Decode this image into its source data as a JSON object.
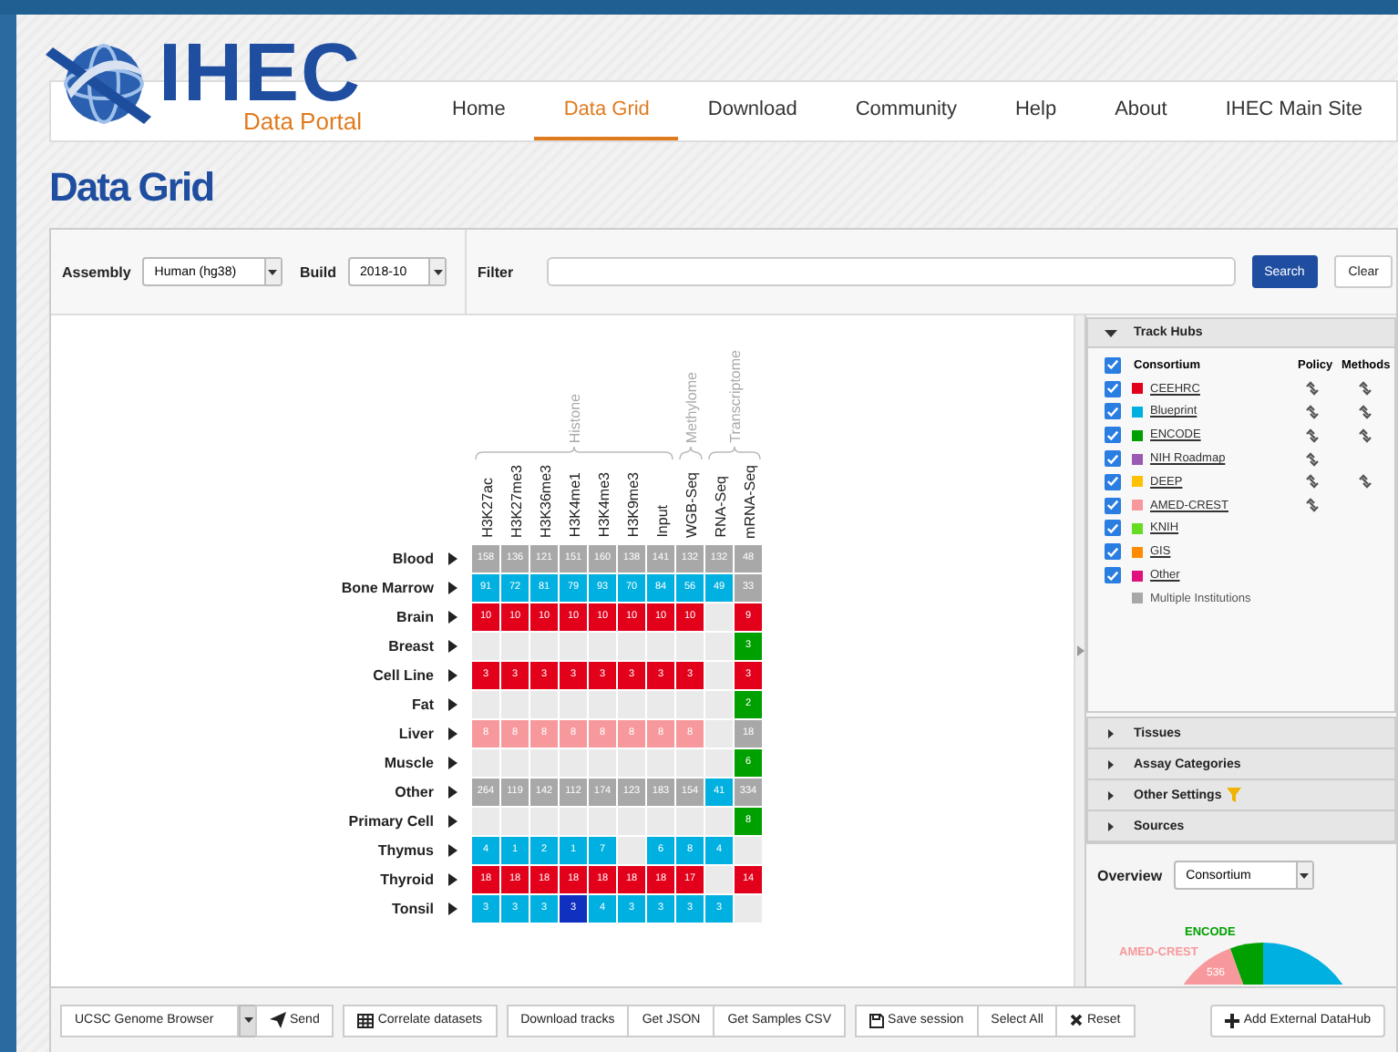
{
  "logo": {
    "title": "IHEC",
    "subtitle": "Data Portal"
  },
  "nav": [
    {
      "label": "Home",
      "selected": false
    },
    {
      "label": "Data Grid",
      "selected": true
    },
    {
      "label": "Download",
      "selected": false
    },
    {
      "label": "Community",
      "selected": false
    },
    {
      "label": "Help",
      "selected": false
    },
    {
      "label": "About",
      "selected": false
    },
    {
      "label": "IHEC Main Site",
      "selected": false
    }
  ],
  "page_title": "Data Grid",
  "filters": {
    "assembly": {
      "label": "Assembly",
      "value": "Human (hg38)"
    },
    "build": {
      "label": "Build",
      "value": "2018-10"
    },
    "filter": {
      "label": "Filter"
    },
    "search_button": "Search",
    "clear_button": "Clear"
  },
  "grid": {
    "groups": [
      {
        "label": "Histone",
        "columns": [
          "H3K27ac",
          "H3K27me3",
          "H3K36me3",
          "H3K4me1",
          "H3K4me3",
          "H3K9me3",
          "Input"
        ]
      },
      {
        "label": "Methylome",
        "columns": [
          "WGB-Seq"
        ]
      },
      {
        "label": "Transcriptome",
        "columns": [
          "RNA-Seq",
          "mRNA-Seq"
        ]
      }
    ],
    "rows": [
      {
        "label": "Blood",
        "cells": [
          {
            "value": "158",
            "color": "#a8a8a8"
          },
          {
            "value": "136",
            "color": "#a8a8a8"
          },
          {
            "value": "121",
            "color": "#a8a8a8"
          },
          {
            "value": "151",
            "color": "#a8a8a8"
          },
          {
            "value": "160",
            "color": "#a8a8a8"
          },
          {
            "value": "138",
            "color": "#a8a8a8"
          },
          {
            "value": "141",
            "color": "#a8a8a8"
          },
          {
            "value": "132",
            "color": "#a8a8a8"
          },
          {
            "value": "132",
            "color": "#a8a8a8"
          },
          {
            "value": "48",
            "color": "#a8a8a8"
          }
        ]
      },
      {
        "label": "Bone Marrow",
        "cells": [
          {
            "value": "91",
            "color": "#00b0e0"
          },
          {
            "value": "72",
            "color": "#00b0e0"
          },
          {
            "value": "81",
            "color": "#00b0e0"
          },
          {
            "value": "79",
            "color": "#00b0e0"
          },
          {
            "value": "93",
            "color": "#00b0e0"
          },
          {
            "value": "70",
            "color": "#00b0e0"
          },
          {
            "value": "84",
            "color": "#00b0e0"
          },
          {
            "value": "56",
            "color": "#00b0e0"
          },
          {
            "value": "49",
            "color": "#00b0e0"
          },
          {
            "value": "33",
            "color": "#a8a8a8"
          }
        ]
      },
      {
        "label": "Brain",
        "cells": [
          {
            "value": "10",
            "color": "#e2001a"
          },
          {
            "value": "10",
            "color": "#e2001a"
          },
          {
            "value": "10",
            "color": "#e2001a"
          },
          {
            "value": "10",
            "color": "#e2001a"
          },
          {
            "value": "10",
            "color": "#e2001a"
          },
          {
            "value": "10",
            "color": "#e2001a"
          },
          {
            "value": "10",
            "color": "#e2001a"
          },
          {
            "value": "10",
            "color": "#e2001a"
          },
          null,
          {
            "value": "9",
            "color": "#e2001a"
          }
        ]
      },
      {
        "label": "Breast",
        "cells": [
          null,
          null,
          null,
          null,
          null,
          null,
          null,
          null,
          null,
          {
            "value": "3",
            "color": "#00a000"
          }
        ]
      },
      {
        "label": "Cell Line",
        "cells": [
          {
            "value": "3",
            "color": "#e2001a"
          },
          {
            "value": "3",
            "color": "#e2001a"
          },
          {
            "value": "3",
            "color": "#e2001a"
          },
          {
            "value": "3",
            "color": "#e2001a"
          },
          {
            "value": "3",
            "color": "#e2001a"
          },
          {
            "value": "3",
            "color": "#e2001a"
          },
          {
            "value": "3",
            "color": "#e2001a"
          },
          {
            "value": "3",
            "color": "#e2001a"
          },
          null,
          {
            "value": "3",
            "color": "#e2001a"
          }
        ]
      },
      {
        "label": "Fat",
        "cells": [
          null,
          null,
          null,
          null,
          null,
          null,
          null,
          null,
          null,
          {
            "value": "2",
            "color": "#00a000"
          }
        ]
      },
      {
        "label": "Liver",
        "cells": [
          {
            "value": "8",
            "color": "#f7999c"
          },
          {
            "value": "8",
            "color": "#f7999c"
          },
          {
            "value": "8",
            "color": "#f7999c"
          },
          {
            "value": "8",
            "color": "#f7999c"
          },
          {
            "value": "8",
            "color": "#f7999c"
          },
          {
            "value": "8",
            "color": "#f7999c"
          },
          {
            "value": "8",
            "color": "#f7999c"
          },
          {
            "value": "8",
            "color": "#f7999c"
          },
          null,
          {
            "value": "18",
            "color": "#a8a8a8"
          }
        ]
      },
      {
        "label": "Muscle",
        "cells": [
          null,
          null,
          null,
          null,
          null,
          null,
          null,
          null,
          null,
          {
            "value": "6",
            "color": "#00a000"
          }
        ]
      },
      {
        "label": "Other",
        "cells": [
          {
            "value": "264",
            "color": "#a8a8a8"
          },
          {
            "value": "119",
            "color": "#a8a8a8"
          },
          {
            "value": "142",
            "color": "#a8a8a8"
          },
          {
            "value": "112",
            "color": "#a8a8a8"
          },
          {
            "value": "174",
            "color": "#a8a8a8"
          },
          {
            "value": "123",
            "color": "#a8a8a8"
          },
          {
            "value": "183",
            "color": "#a8a8a8"
          },
          {
            "value": "154",
            "color": "#a8a8a8"
          },
          {
            "value": "41",
            "color": "#00b0e0"
          },
          {
            "value": "334",
            "color": "#a8a8a8"
          }
        ]
      },
      {
        "label": "Primary Cell",
        "cells": [
          null,
          null,
          null,
          null,
          null,
          null,
          null,
          null,
          null,
          {
            "value": "8",
            "color": "#00a000"
          }
        ]
      },
      {
        "label": "Thymus",
        "cells": [
          {
            "value": "4",
            "color": "#00b0e0"
          },
          {
            "value": "1",
            "color": "#00b0e0"
          },
          {
            "value": "2",
            "color": "#00b0e0"
          },
          {
            "value": "1",
            "color": "#00b0e0"
          },
          {
            "value": "7",
            "color": "#00b0e0"
          },
          null,
          {
            "value": "6",
            "color": "#00b0e0"
          },
          {
            "value": "8",
            "color": "#00b0e0"
          },
          {
            "value": "4",
            "color": "#00b0e0"
          },
          null
        ]
      },
      {
        "label": "Thyroid",
        "cells": [
          {
            "value": "18",
            "color": "#e2001a"
          },
          {
            "value": "18",
            "color": "#e2001a"
          },
          {
            "value": "18",
            "color": "#e2001a"
          },
          {
            "value": "18",
            "color": "#e2001a"
          },
          {
            "value": "18",
            "color": "#e2001a"
          },
          {
            "value": "18",
            "color": "#e2001a"
          },
          {
            "value": "18",
            "color": "#e2001a"
          },
          {
            "value": "17",
            "color": "#e2001a"
          },
          null,
          {
            "value": "14",
            "color": "#e2001a"
          }
        ]
      },
      {
        "label": "Tonsil",
        "cells": [
          {
            "value": "3",
            "color": "#00b0e0"
          },
          {
            "value": "3",
            "color": "#00b0e0"
          },
          {
            "value": "3",
            "color": "#00b0e0"
          },
          {
            "value": "3",
            "color": "#1030c0"
          },
          {
            "value": "4",
            "color": "#00b0e0"
          },
          {
            "value": "3",
            "color": "#00b0e0"
          },
          {
            "value": "3",
            "color": "#00b0e0"
          },
          {
            "value": "3",
            "color": "#00b0e0"
          },
          {
            "value": "3",
            "color": "#00b0e0"
          },
          null
        ]
      }
    ]
  },
  "track_hubs": {
    "title": "Track Hubs",
    "expanded": true,
    "header": {
      "checked": true,
      "consortium": "Consortium",
      "policy": "Policy",
      "methods": "Methods"
    },
    "items": [
      {
        "name": "CEEHRC",
        "color": "#e2001a",
        "checked": true,
        "policy": true,
        "methods": true
      },
      {
        "name": "Blueprint",
        "color": "#00b0e0",
        "checked": true,
        "policy": true,
        "methods": true
      },
      {
        "name": "ENCODE",
        "color": "#00a000",
        "checked": true,
        "policy": true,
        "methods": true
      },
      {
        "name": "NIH Roadmap",
        "color": "#9b59b6",
        "checked": true,
        "policy": true,
        "methods": false
      },
      {
        "name": "DEEP",
        "color": "#ffc000",
        "checked": true,
        "policy": true,
        "methods": true
      },
      {
        "name": "AMED-CREST",
        "color": "#f7999c",
        "checked": true,
        "policy": true,
        "methods": false
      },
      {
        "name": "KNIH",
        "color": "#66dd22",
        "checked": true,
        "policy": false,
        "methods": false
      },
      {
        "name": "GIS",
        "color": "#ff8c00",
        "checked": true,
        "policy": false,
        "methods": false
      },
      {
        "name": "Other",
        "color": "#e0117f",
        "checked": true,
        "policy": false,
        "methods": false
      }
    ],
    "legend": {
      "name": "Multiple Institutions",
      "color": "#a8a8a8"
    }
  },
  "sections": [
    {
      "label": "Tissues",
      "expanded": false,
      "filtered": false
    },
    {
      "label": "Assay Categories",
      "expanded": false,
      "filtered": false
    },
    {
      "label": "Other Settings",
      "expanded": false,
      "filtered": true
    },
    {
      "label": "Sources",
      "expanded": false,
      "filtered": false
    }
  ],
  "overview": {
    "label": "Overview",
    "value": "Consortium",
    "chart_labels": [
      {
        "text": "ENCODE",
        "color": "#00a000"
      },
      {
        "text": "AMED-CREST",
        "color": "#f7999c"
      }
    ],
    "slice_label": "536"
  },
  "toolbar": {
    "browser": "UCSC Genome Browser",
    "groups": [
      [
        {
          "label": "Send",
          "kind": "send"
        }
      ],
      [
        {
          "label": "Correlate datasets",
          "kind": "table"
        }
      ],
      [
        {
          "label": "Download tracks",
          "kind": "plain"
        },
        {
          "label": "Get JSON",
          "kind": "plain"
        },
        {
          "label": "Get Samples CSV",
          "kind": "plain"
        }
      ],
      [
        {
          "label": "Save session",
          "kind": "save"
        },
        {
          "label": "Select All",
          "kind": "plain"
        },
        {
          "label": "Reset",
          "kind": "reset"
        }
      ]
    ],
    "extra": {
      "label": "Add External DataHub",
      "kind": "add"
    }
  }
}
